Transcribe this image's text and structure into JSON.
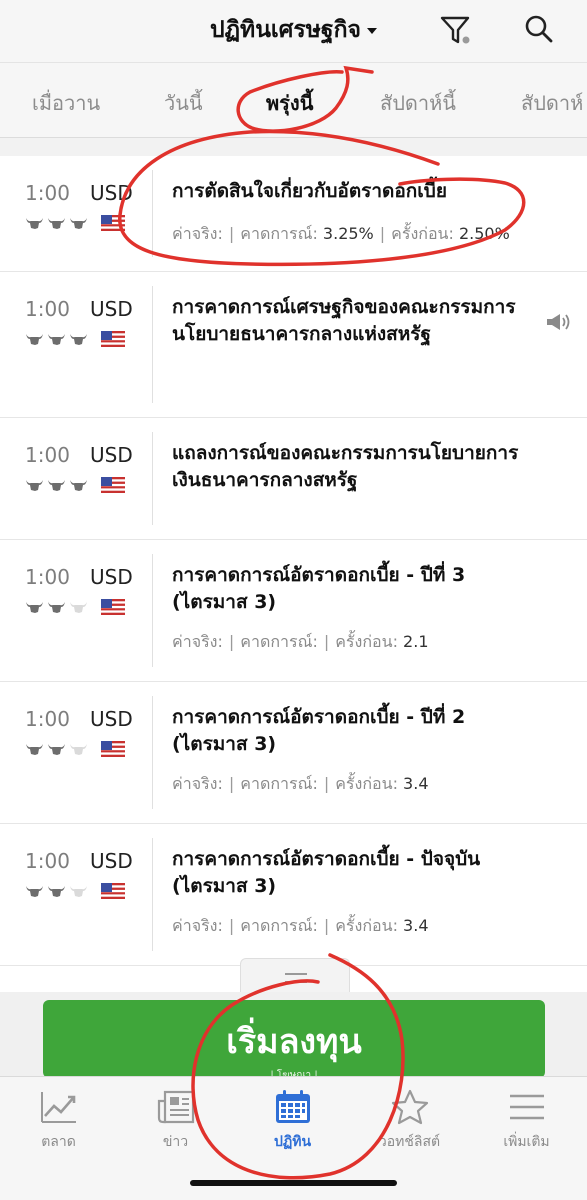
{
  "header": {
    "title": "ปฏิทินเศรษฐกิจ"
  },
  "tabs": [
    {
      "label": "เมื่อวาน",
      "active": false
    },
    {
      "label": "วันนี้",
      "active": false
    },
    {
      "label": "พรุ่งนี้",
      "active": true
    },
    {
      "label": "สัปดาห์นี้",
      "active": false
    },
    {
      "label": "สัปดาห์",
      "active": false
    }
  ],
  "events": [
    {
      "time": "1:00",
      "currency": "USD",
      "importance": 3,
      "flag": "us-flag-icon",
      "title": "การตัดสินใจเกี่ยวกับอัตราดอกเบี้ย",
      "actual_label": "ค่าจริง:",
      "actual": "",
      "forecast_label": "คาดการณ์:",
      "forecast": "3.25%",
      "previous_label": "ครั้งก่อน:",
      "previous": "2.50%"
    },
    {
      "time": "1:00",
      "currency": "USD",
      "importance": 3,
      "flag": "us-flag-icon",
      "title": "การคาดการณ์เศรษฐกิจของคณะกรรมการนโยบายธนาคารกลางแห่งสหรัฐ",
      "speaker": true
    },
    {
      "time": "1:00",
      "currency": "USD",
      "importance": 3,
      "flag": "us-flag-icon",
      "title": "แถลงการณ์ของคณะกรรมการนโยบายการเงินธนาคารกลางสหรัฐ"
    },
    {
      "time": "1:00",
      "currency": "USD",
      "importance": 2,
      "flag": "us-flag-icon",
      "title": "การคาดการณ์อัตราดอกเบี้ย - ปีที่ 3 (ไตรมาส 3)",
      "actual_label": "ค่าจริง:",
      "actual": "",
      "forecast_label": "คาดการณ์:",
      "forecast": "",
      "previous_label": "ครั้งก่อน:",
      "previous": "2.1"
    },
    {
      "time": "1:00",
      "currency": "USD",
      "importance": 2,
      "flag": "us-flag-icon",
      "title": "การคาดการณ์อัตราดอกเบี้ย - ปีที่ 2 (ไตรมาส 3)",
      "actual_label": "ค่าจริง:",
      "actual": "",
      "forecast_label": "คาดการณ์:",
      "forecast": "",
      "previous_label": "ครั้งก่อน:",
      "previous": "3.4"
    },
    {
      "time": "1:00",
      "currency": "USD",
      "importance": 2,
      "flag": "us-flag-icon",
      "title": "การคาดการณ์อัตราดอกเบี้ย - ปัจจุบัน (ไตรมาส 3)",
      "actual_label": "ค่าจริง:",
      "actual": "",
      "forecast_label": "คาดการณ์:",
      "forecast": "",
      "previous_label": "ครั้งก่อน:",
      "previous": "3.4"
    }
  ],
  "ad": {
    "label": "เริ่มลงทุน",
    "sub": "| โฆษณา |"
  },
  "nav": [
    {
      "label": "ตลาด",
      "icon": "chart-line-icon",
      "active": false
    },
    {
      "label": "ข่าว",
      "icon": "newspaper-icon",
      "active": false
    },
    {
      "label": "ปฏิทิน",
      "icon": "calendar-icon",
      "active": true
    },
    {
      "label": "วอทช์ลิสต์",
      "icon": "star-icon",
      "active": false
    },
    {
      "label": "เพิ่มเติม",
      "icon": "menu-icon",
      "active": false
    }
  ],
  "colors": {
    "accent": "#2f6fd6",
    "cta": "#3fa63a",
    "annotation": "#e0322c"
  }
}
